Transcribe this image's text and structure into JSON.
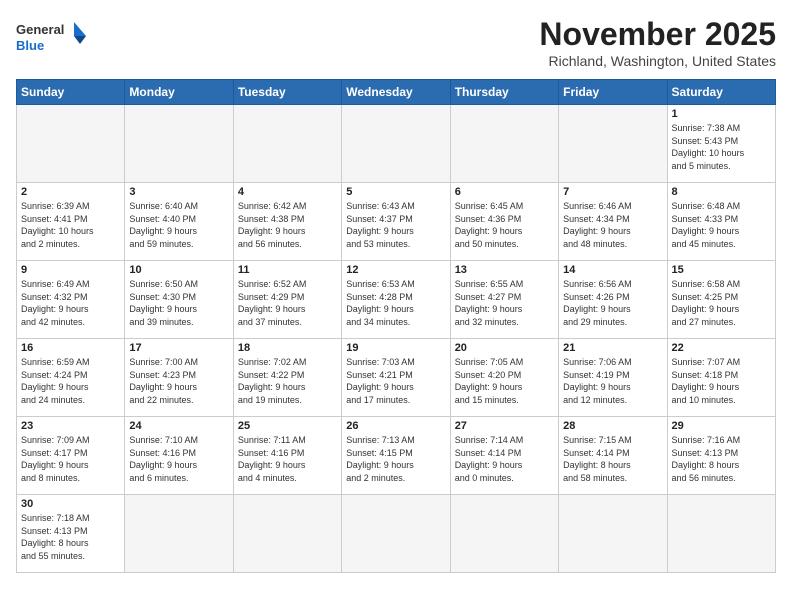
{
  "header": {
    "logo_general": "General",
    "logo_blue": "Blue",
    "month_title": "November 2025",
    "location": "Richland, Washington, United States"
  },
  "days_of_week": [
    "Sunday",
    "Monday",
    "Tuesday",
    "Wednesday",
    "Thursday",
    "Friday",
    "Saturday"
  ],
  "weeks": [
    [
      {
        "day": "",
        "info": ""
      },
      {
        "day": "",
        "info": ""
      },
      {
        "day": "",
        "info": ""
      },
      {
        "day": "",
        "info": ""
      },
      {
        "day": "",
        "info": ""
      },
      {
        "day": "",
        "info": ""
      },
      {
        "day": "1",
        "info": "Sunrise: 7:38 AM\nSunset: 5:43 PM\nDaylight: 10 hours\nand 5 minutes."
      }
    ],
    [
      {
        "day": "2",
        "info": "Sunrise: 6:39 AM\nSunset: 4:41 PM\nDaylight: 10 hours\nand 2 minutes."
      },
      {
        "day": "3",
        "info": "Sunrise: 6:40 AM\nSunset: 4:40 PM\nDaylight: 9 hours\nand 59 minutes."
      },
      {
        "day": "4",
        "info": "Sunrise: 6:42 AM\nSunset: 4:38 PM\nDaylight: 9 hours\nand 56 minutes."
      },
      {
        "day": "5",
        "info": "Sunrise: 6:43 AM\nSunset: 4:37 PM\nDaylight: 9 hours\nand 53 minutes."
      },
      {
        "day": "6",
        "info": "Sunrise: 6:45 AM\nSunset: 4:36 PM\nDaylight: 9 hours\nand 50 minutes."
      },
      {
        "day": "7",
        "info": "Sunrise: 6:46 AM\nSunset: 4:34 PM\nDaylight: 9 hours\nand 48 minutes."
      },
      {
        "day": "8",
        "info": "Sunrise: 6:48 AM\nSunset: 4:33 PM\nDaylight: 9 hours\nand 45 minutes."
      }
    ],
    [
      {
        "day": "9",
        "info": "Sunrise: 6:49 AM\nSunset: 4:32 PM\nDaylight: 9 hours\nand 42 minutes."
      },
      {
        "day": "10",
        "info": "Sunrise: 6:50 AM\nSunset: 4:30 PM\nDaylight: 9 hours\nand 39 minutes."
      },
      {
        "day": "11",
        "info": "Sunrise: 6:52 AM\nSunset: 4:29 PM\nDaylight: 9 hours\nand 37 minutes."
      },
      {
        "day": "12",
        "info": "Sunrise: 6:53 AM\nSunset: 4:28 PM\nDaylight: 9 hours\nand 34 minutes."
      },
      {
        "day": "13",
        "info": "Sunrise: 6:55 AM\nSunset: 4:27 PM\nDaylight: 9 hours\nand 32 minutes."
      },
      {
        "day": "14",
        "info": "Sunrise: 6:56 AM\nSunset: 4:26 PM\nDaylight: 9 hours\nand 29 minutes."
      },
      {
        "day": "15",
        "info": "Sunrise: 6:58 AM\nSunset: 4:25 PM\nDaylight: 9 hours\nand 27 minutes."
      }
    ],
    [
      {
        "day": "16",
        "info": "Sunrise: 6:59 AM\nSunset: 4:24 PM\nDaylight: 9 hours\nand 24 minutes."
      },
      {
        "day": "17",
        "info": "Sunrise: 7:00 AM\nSunset: 4:23 PM\nDaylight: 9 hours\nand 22 minutes."
      },
      {
        "day": "18",
        "info": "Sunrise: 7:02 AM\nSunset: 4:22 PM\nDaylight: 9 hours\nand 19 minutes."
      },
      {
        "day": "19",
        "info": "Sunrise: 7:03 AM\nSunset: 4:21 PM\nDaylight: 9 hours\nand 17 minutes."
      },
      {
        "day": "20",
        "info": "Sunrise: 7:05 AM\nSunset: 4:20 PM\nDaylight: 9 hours\nand 15 minutes."
      },
      {
        "day": "21",
        "info": "Sunrise: 7:06 AM\nSunset: 4:19 PM\nDaylight: 9 hours\nand 12 minutes."
      },
      {
        "day": "22",
        "info": "Sunrise: 7:07 AM\nSunset: 4:18 PM\nDaylight: 9 hours\nand 10 minutes."
      }
    ],
    [
      {
        "day": "23",
        "info": "Sunrise: 7:09 AM\nSunset: 4:17 PM\nDaylight: 9 hours\nand 8 minutes."
      },
      {
        "day": "24",
        "info": "Sunrise: 7:10 AM\nSunset: 4:16 PM\nDaylight: 9 hours\nand 6 minutes."
      },
      {
        "day": "25",
        "info": "Sunrise: 7:11 AM\nSunset: 4:16 PM\nDaylight: 9 hours\nand 4 minutes."
      },
      {
        "day": "26",
        "info": "Sunrise: 7:13 AM\nSunset: 4:15 PM\nDaylight: 9 hours\nand 2 minutes."
      },
      {
        "day": "27",
        "info": "Sunrise: 7:14 AM\nSunset: 4:14 PM\nDaylight: 9 hours\nand 0 minutes."
      },
      {
        "day": "28",
        "info": "Sunrise: 7:15 AM\nSunset: 4:14 PM\nDaylight: 8 hours\nand 58 minutes."
      },
      {
        "day": "29",
        "info": "Sunrise: 7:16 AM\nSunset: 4:13 PM\nDaylight: 8 hours\nand 56 minutes."
      }
    ],
    [
      {
        "day": "30",
        "info": "Sunrise: 7:18 AM\nSunset: 4:13 PM\nDaylight: 8 hours\nand 55 minutes."
      },
      {
        "day": "",
        "info": ""
      },
      {
        "day": "",
        "info": ""
      },
      {
        "day": "",
        "info": ""
      },
      {
        "day": "",
        "info": ""
      },
      {
        "day": "",
        "info": ""
      },
      {
        "day": "",
        "info": ""
      }
    ]
  ]
}
